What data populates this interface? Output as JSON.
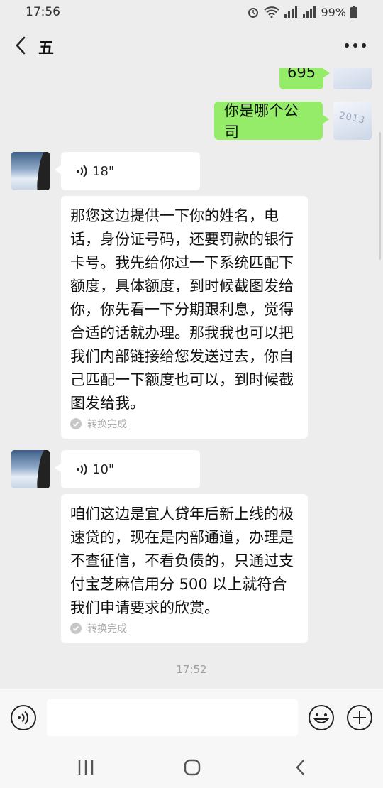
{
  "status_bar": {
    "time": "17:56",
    "battery": "99%"
  },
  "header": {
    "title": "五"
  },
  "messages": {
    "outgoing_partial": "695",
    "outgoing_question": "你是哪个公司",
    "avatar_snow_text": "2013",
    "voice1": {
      "duration": "18\"",
      "transcript": "那您这边提供一下你的姓名，电话，身份证号码，还要罚款的银行卡号。我先给你过一下系统匹配下额度，具体额度，到时候截图发给你，你先看一下分期跟利息，觉得合适的话就办理。那我我也可以把我们内部链接给您发送过去，你自己匹配一下额度也可以，到时候截图发给我。",
      "status": "转换完成"
    },
    "voice2": {
      "duration": "10\"",
      "transcript": "咱们这边是宜人贷年后新上线的极速贷的，现在是内部通道，办理是不查征信，不看负债的，只通过支付宝芝麻信用分 500 以上就符合我们申请要求的欣赏。",
      "status": "转换完成"
    },
    "timestamp": "17:52"
  },
  "icons": [
    "back-icon",
    "more-icon",
    "voice-input-icon",
    "emoji-icon",
    "add-icon",
    "recent-apps-icon",
    "home-icon",
    "nav-back-icon"
  ],
  "colors": {
    "outgoing_bubble": "#95ec69",
    "background": "#ededed"
  }
}
